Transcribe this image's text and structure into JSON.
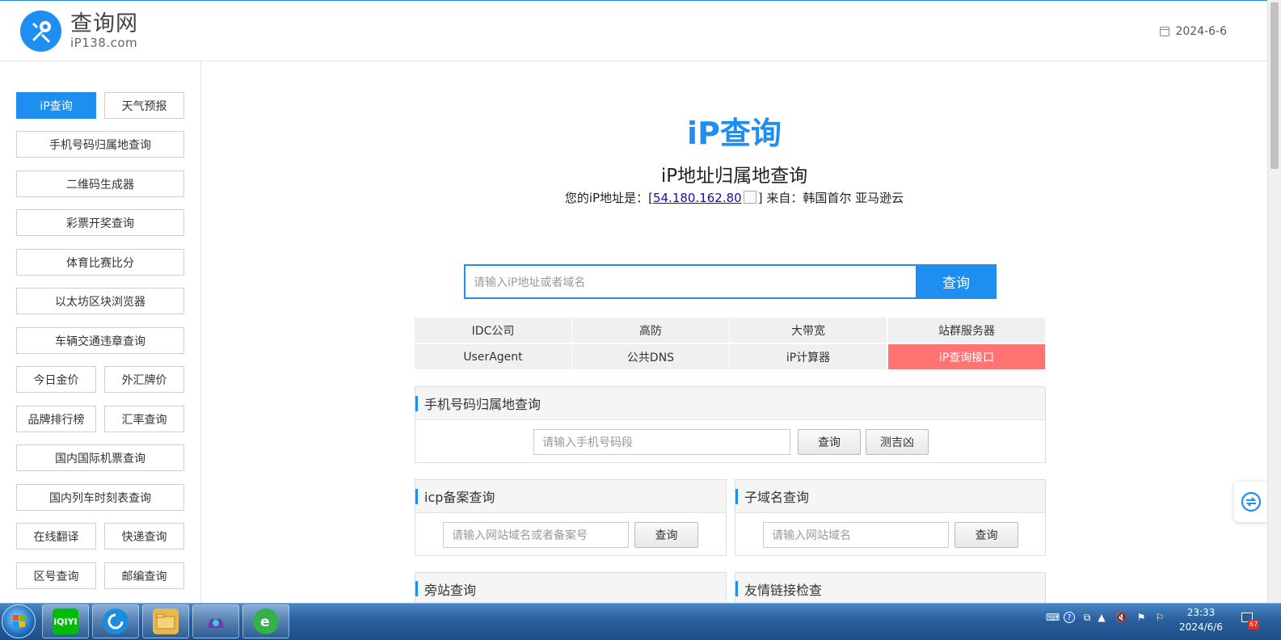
{
  "header": {
    "logo_cn": "查询网",
    "logo_en": "iP138.com",
    "date": "2024-6-6"
  },
  "sidebar": {
    "items": [
      {
        "label": "iP查询",
        "active": true
      },
      {
        "label": "天气预报"
      },
      {
        "label": "手机号码归属地查询"
      },
      {
        "label": "二维码生成器"
      },
      {
        "label": "彩票开奖查询"
      },
      {
        "label": "体育比赛比分"
      },
      {
        "label": "以太坊区块浏览器"
      },
      {
        "label": "车辆交通违章查询"
      },
      {
        "label": "今日金价"
      },
      {
        "label": "外汇牌价"
      },
      {
        "label": "品牌排行榜"
      },
      {
        "label": "汇率查询"
      },
      {
        "label": "国内国际机票查询"
      },
      {
        "label": "国内列车时刻表查询"
      },
      {
        "label": "在线翻译"
      },
      {
        "label": "快递查询"
      },
      {
        "label": "区号查询"
      },
      {
        "label": "邮编查询"
      }
    ]
  },
  "main": {
    "title": "iP查询",
    "subtitle": "iP地址归属地查询",
    "ip_prefix": "您的iP地址是：[",
    "ip_value": "54.180.162.80",
    "ip_suffix": "] 来自：韩国首尔 亚马逊云",
    "search_placeholder": "请输入iP地址或者域名",
    "search_button": "查询"
  },
  "links": [
    [
      "IDC公司",
      "高防",
      "大带宽",
      "站群服务器"
    ],
    [
      "UserAgent",
      "公共DNS",
      "iP计算器",
      "iP查询接口"
    ]
  ],
  "panels": {
    "phone": {
      "title": "手机号码归属地查询",
      "placeholder": "请输入手机号码段",
      "button": "查询",
      "button2": "测吉凶"
    },
    "icp": {
      "title": "icp备案查询",
      "placeholder": "请输入网站域名或者备案号",
      "button": "查询"
    },
    "subdomain": {
      "title": "子域名查询",
      "placeholder": "请输入网站域名",
      "button": "查询"
    },
    "side_site": {
      "title": "旁站查询"
    },
    "friend_link": {
      "title": "友情链接检查"
    }
  },
  "taskbar": {
    "apps": [
      {
        "name": "iqiyi-icon",
        "label": "iQIYI",
        "color": "#00be06"
      },
      {
        "name": "browser-360-icon",
        "label": "",
        "color": "#1a8de0"
      },
      {
        "name": "file-explorer-icon",
        "label": "",
        "color": "#e8b84a"
      },
      {
        "name": "media-app-icon",
        "label": "",
        "color": "#6a3fa0"
      },
      {
        "name": "ie-browser-icon",
        "label": "",
        "color": "#35b04a"
      }
    ],
    "time": "23:33",
    "date": "2024/6/6",
    "badge": "67"
  },
  "colors": {
    "brand_blue": "#1e8ef0",
    "link_red": "#ff7373"
  }
}
